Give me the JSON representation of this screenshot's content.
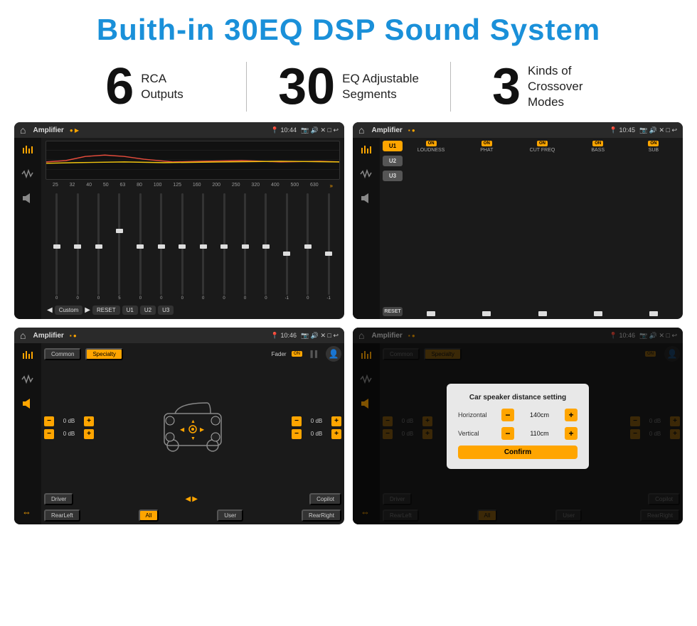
{
  "header": {
    "title": "Buith-in 30EQ DSP Sound System"
  },
  "stats": [
    {
      "number": "6",
      "label": "RCA\nOutputs"
    },
    {
      "number": "30",
      "label": "EQ Adjustable\nSegments"
    },
    {
      "number": "3",
      "label": "Kinds of\nCrossover Modes"
    }
  ],
  "screens": [
    {
      "id": "eq-screen",
      "time": "10:44",
      "title": "Amplifier",
      "freq_labels": [
        "25",
        "32",
        "40",
        "50",
        "63",
        "80",
        "100",
        "125",
        "160",
        "200",
        "250",
        "320",
        "400",
        "500",
        "630"
      ],
      "slider_values": [
        "0",
        "0",
        "0",
        "5",
        "0",
        "0",
        "0",
        "0",
        "0",
        "0",
        "0",
        "-1",
        "0",
        "-1"
      ],
      "bottom_buttons": [
        "Custom",
        "RESET",
        "U1",
        "U2",
        "U3"
      ]
    },
    {
      "id": "crossover-screen",
      "time": "10:45",
      "title": "Amplifier",
      "u_buttons": [
        "U1",
        "U2",
        "U3"
      ],
      "groups": [
        {
          "label": "LOUDNESS",
          "on": true
        },
        {
          "label": "PHAT",
          "on": true
        },
        {
          "label": "CUT FREQ",
          "on": true
        },
        {
          "label": "BASS",
          "on": true
        },
        {
          "label": "SUB",
          "on": true
        }
      ]
    },
    {
      "id": "fader-screen",
      "time": "10:46",
      "title": "Amplifier",
      "tabs": [
        "Common",
        "Specialty"
      ],
      "fader_label": "Fader",
      "fader_on": true,
      "db_values": [
        "0 dB",
        "0 dB",
        "0 dB",
        "0 dB"
      ],
      "bottom_buttons": [
        "Driver",
        "",
        "Copilot",
        "RearLeft",
        "All",
        "User",
        "RearRight"
      ]
    },
    {
      "id": "distance-screen",
      "time": "10:46",
      "title": "Amplifier",
      "dialog": {
        "title": "Car speaker distance setting",
        "horizontal_label": "Horizontal",
        "horizontal_value": "140cm",
        "vertical_label": "Vertical",
        "vertical_value": "110cm",
        "confirm_label": "Confirm"
      },
      "db_values": [
        "0 dB",
        "0 dB"
      ],
      "bottom_buttons": [
        "Driver",
        "Copilot",
        "RearLeft",
        "User",
        "RearRight"
      ]
    }
  ]
}
